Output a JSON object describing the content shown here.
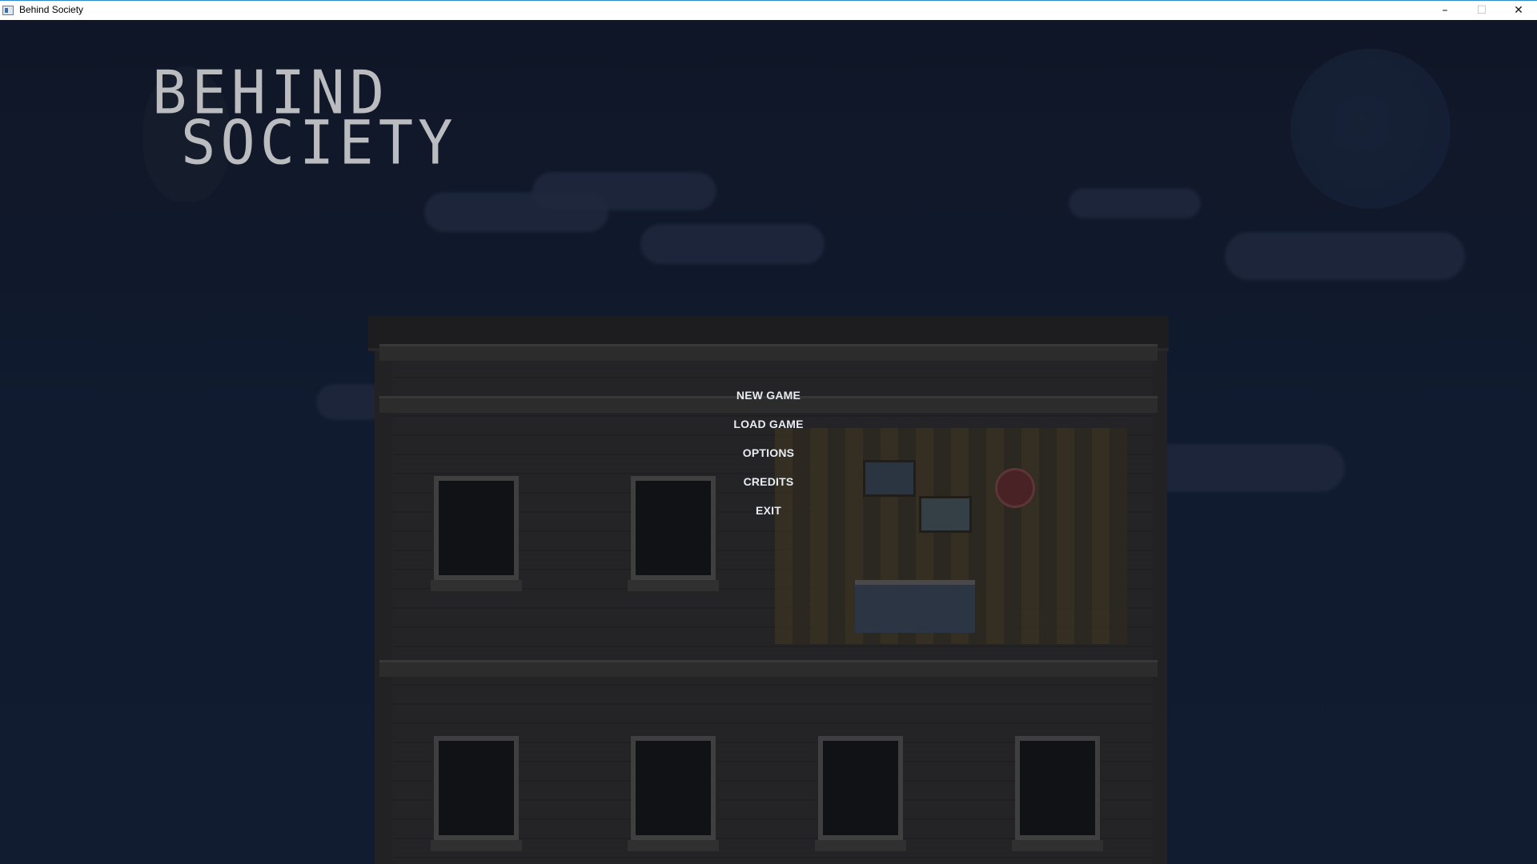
{
  "window": {
    "title": "Behind Society",
    "controls": {
      "minimize": "–",
      "maximize": "☐",
      "close": "✕"
    }
  },
  "logo": {
    "line1": "BEHIND",
    "line2": "SOCIETY"
  },
  "menu": {
    "items": [
      {
        "label": "NEW GAME"
      },
      {
        "label": "LOAD GAME"
      },
      {
        "label": "OPTIONS"
      },
      {
        "label": "CREDITS"
      },
      {
        "label": "EXIT"
      }
    ]
  },
  "colors": {
    "sky": "#111a2a",
    "menu_text": "#e8ecf2",
    "logo_text": "#ffffff"
  }
}
